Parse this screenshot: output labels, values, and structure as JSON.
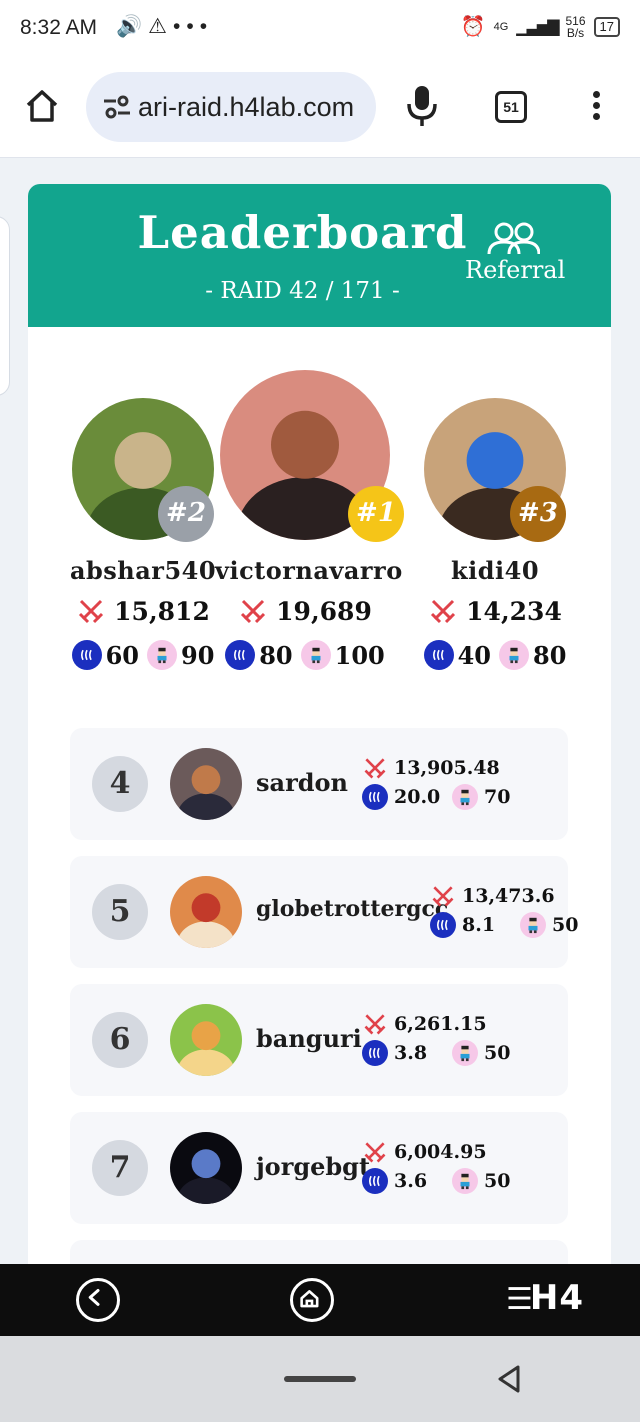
{
  "status_bar": {
    "time": "8:32 AM",
    "network_speed": "516",
    "network_speed_unit": "B/s",
    "network_type": "4G",
    "battery": "17",
    "icons": [
      "volume-icon",
      "warning-icon",
      "more-dots-icon",
      "alarm-icon",
      "signal-icon",
      "battery-icon"
    ]
  },
  "browser": {
    "url": "ari-raid.h4lab.com",
    "tab_count": "51"
  },
  "header": {
    "title": "Leaderboard",
    "referral_label": "Referral",
    "raid_label": "- RAID 42 / 171 -"
  },
  "podium": [
    {
      "rank_badge": "#2",
      "name": "abshar540",
      "score": "15,812",
      "steem": "60",
      "pixel": "90",
      "badge_color": "#9aa0a8",
      "avatar_colors": [
        "#6a8c3a",
        "#c9b48a",
        "#3b5a23"
      ]
    },
    {
      "rank_badge": "#1",
      "name": "victornavarro",
      "score": "19,689",
      "steem": "80",
      "pixel": "100",
      "badge_color": "#f5c518",
      "avatar_colors": [
        "#d98c7f",
        "#a05a3e",
        "#2a2020"
      ]
    },
    {
      "rank_badge": "#3",
      "name": "kidi40",
      "score": "14,234",
      "steem": "40",
      "pixel": "80",
      "badge_color": "#a86a12",
      "avatar_colors": [
        "#c8a37a",
        "#2f6fd6",
        "#3a2a20"
      ]
    }
  ],
  "rows": [
    {
      "rank": "4",
      "name": "sardon",
      "score": "13,905.48",
      "steem": "20.0",
      "pixel": "70",
      "avatar_colors": [
        "#6b5a5a",
        "#c07a4a",
        "#2a2a3a"
      ]
    },
    {
      "rank": "5",
      "name": "globetrottergcc",
      "score": "13,473.6",
      "steem": "8.1",
      "pixel": "50",
      "avatar_colors": [
        "#e08a4a",
        "#c23a2a",
        "#f4e2c8"
      ]
    },
    {
      "rank": "6",
      "name": "banguri",
      "score": "6,261.15",
      "steem": "3.8",
      "pixel": "50",
      "avatar_colors": [
        "#8bc34a",
        "#e8a347",
        "#f4d58a"
      ]
    },
    {
      "rank": "7",
      "name": "jorgebgt",
      "score": "6,004.95",
      "steem": "3.6",
      "pixel": "50",
      "avatar_colors": [
        "#0a0a10",
        "#5a7ac8",
        "#1a1a28"
      ]
    }
  ],
  "bottom_nav": {
    "brand": "H4"
  },
  "colors": {
    "header_bg": "#12a58e",
    "sword_red": "#e0424a",
    "steem_blue": "#1b2fbf"
  }
}
